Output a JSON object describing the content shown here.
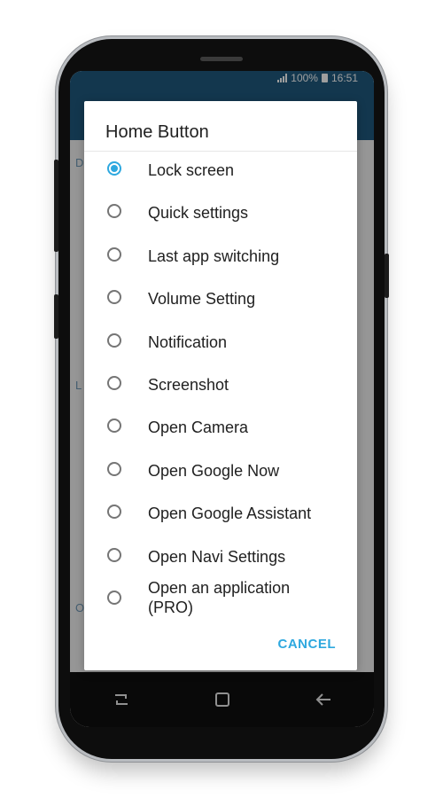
{
  "status_bar": {
    "battery": "100%",
    "time": "16:51"
  },
  "background": {
    "letters": [
      "D",
      "L",
      "O"
    ]
  },
  "dialog": {
    "title": "Home Button",
    "selected_index": 0,
    "options": [
      {
        "label": "Lock screen"
      },
      {
        "label": "Quick settings"
      },
      {
        "label": "Last app switching"
      },
      {
        "label": "Volume Setting"
      },
      {
        "label": "Notification"
      },
      {
        "label": "Screenshot"
      },
      {
        "label": "Open Camera"
      },
      {
        "label": "Open Google Now"
      },
      {
        "label": "Open Google Assistant"
      },
      {
        "label": "Open Navi Settings"
      },
      {
        "label": "Open an application",
        "label2": "(PRO)"
      }
    ],
    "cancel_label": "CANCEL"
  },
  "colors": {
    "accent": "#2ea8df",
    "app_bar": "#1f5a7f"
  }
}
